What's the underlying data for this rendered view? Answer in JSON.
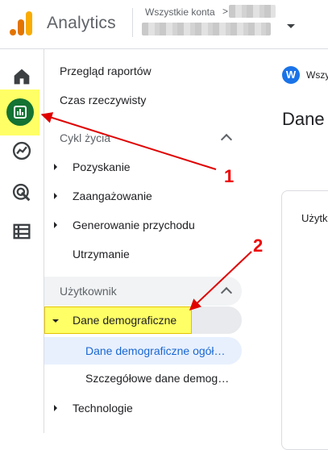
{
  "header": {
    "app_title": "Analytics",
    "account_label": "Wszystkie konta",
    "account_chevron": ">"
  },
  "rail": {
    "items": [
      "home-icon",
      "reports-icon",
      "explore-icon",
      "advertising-icon",
      "configure-icon"
    ]
  },
  "nav": {
    "reports_snapshot": "Przegląd raportów",
    "realtime": "Czas rzeczywisty",
    "lifecycle": {
      "label": "Cykl życia",
      "items": [
        "Pozyskanie",
        "Zaangażowanie",
        "Generowanie przychodu",
        "Utrzymanie"
      ]
    },
    "user": {
      "label": "Użytkownik",
      "demographics": "Dane demograficzne",
      "demographics_overview": "Dane demograficzne ogół…",
      "demographics_details": "Szczegółowe dane demog…",
      "technology": "Technologie"
    }
  },
  "main": {
    "workspace_initial": "W",
    "workspace_label": "Wszy",
    "title": "Dane",
    "card_label": "Użytk"
  },
  "annotations": {
    "label_1": "1",
    "label_2": "2"
  },
  "colors": {
    "highlight": "#ffff66",
    "annotation": "#e00000",
    "reports_green": "#137333",
    "selected_blue": "#1967d2"
  }
}
